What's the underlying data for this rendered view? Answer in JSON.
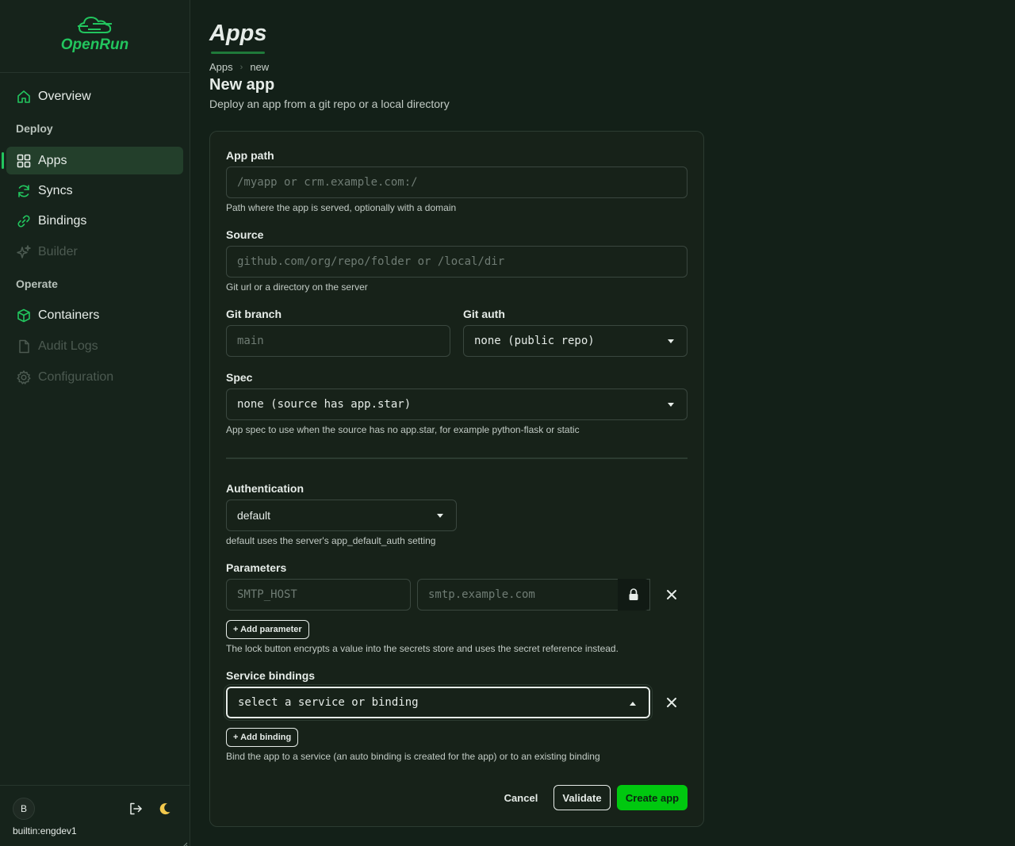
{
  "app": {
    "name": "OpenRun"
  },
  "sidebar": {
    "items": [
      {
        "label": "Overview",
        "icon": "home-icon"
      },
      {
        "label": "Apps",
        "icon": "grid-icon",
        "active": true
      },
      {
        "label": "Syncs",
        "icon": "sync-icon"
      },
      {
        "label": "Bindings",
        "icon": "link-icon"
      },
      {
        "label": "Builder",
        "icon": "sparkles-icon",
        "disabled": true
      },
      {
        "label": "Containers",
        "icon": "box-icon"
      },
      {
        "label": "Audit Logs",
        "icon": "document-icon",
        "disabled": true
      },
      {
        "label": "Configuration",
        "icon": "gear-icon",
        "disabled": true
      }
    ],
    "sections": {
      "deploy": "Deploy",
      "operate": "Operate"
    },
    "user": {
      "initial": "B",
      "name": "builtin:engdev1"
    }
  },
  "page": {
    "title": "Apps",
    "breadcrumb": [
      "Apps",
      "new"
    ],
    "heading": "New app",
    "subheading": "Deploy an app from a git repo or a local directory"
  },
  "form": {
    "app_path": {
      "label": "App path",
      "placeholder": "/myapp or crm.example.com:/",
      "hint": "Path where the app is served, optionally with a domain"
    },
    "source": {
      "label": "Source",
      "placeholder": "github.com/org/repo/folder or /local/dir",
      "hint": "Git url or a directory on the server"
    },
    "git_branch": {
      "label": "Git branch",
      "placeholder": "main"
    },
    "git_auth": {
      "label": "Git auth",
      "value": "none (public repo)"
    },
    "spec": {
      "label": "Spec",
      "value": "none (source has app.star)",
      "hint": "App spec to use when the source has no app.star, for example python-flask or static"
    },
    "authentication": {
      "label": "Authentication",
      "value": "default",
      "hint": "default uses the server's app_default_auth setting"
    },
    "parameters": {
      "label": "Parameters",
      "key_placeholder": "SMTP_HOST",
      "value_placeholder": "smtp.example.com",
      "add_label": "+ Add parameter",
      "hint": "The lock button encrypts a value into the secrets store and uses the secret reference instead."
    },
    "service_bindings": {
      "label": "Service bindings",
      "value": "select a service or binding",
      "add_label": "+ Add binding",
      "hint": "Bind the app to a service (an auto binding is created for the app) or to an existing binding"
    },
    "actions": {
      "cancel": "Cancel",
      "validate": "Validate",
      "create": "Create app"
    }
  },
  "colors": {
    "accent": "#22c55e",
    "primary_button": "#00c80f",
    "background": "#132018"
  }
}
